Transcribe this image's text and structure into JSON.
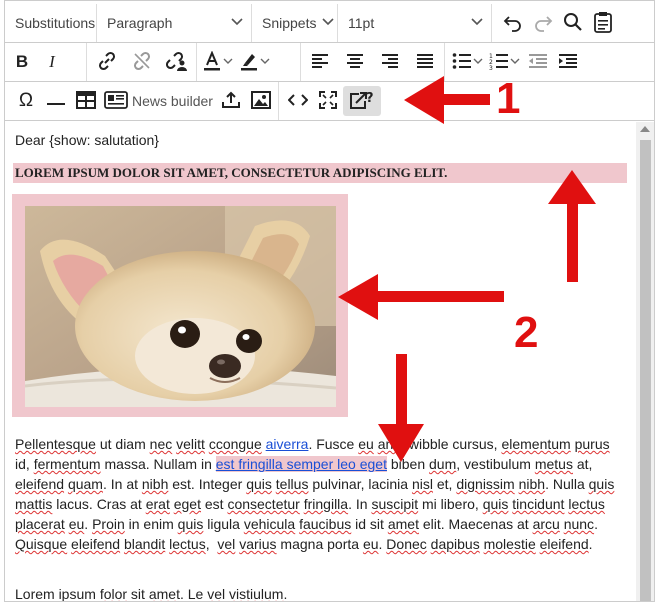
{
  "toolbar": {
    "row1": {
      "substitutions": "Substitutions",
      "paragraph": "Paragraph",
      "snippets": "Snippets",
      "font_size": "11pt"
    },
    "row3": {
      "news_builder": "News builder"
    }
  },
  "annotations": [
    "1",
    "2"
  ],
  "content": {
    "greeting": "Dear {show: salutation}",
    "heading": "LOREM IPSUM DOLOR SIT AMET, CONSECTETUR ADIPISCING ELIT.",
    "paragraph": {
      "s1": "Pellentesque",
      "s2": " ut diam ",
      "s3": "nec",
      "s4": " ",
      "s5": "velitt",
      "s6": " ",
      "s7": "ccongue",
      "s8": " ",
      "link1": "aiverra",
      "s9": ". Fusce ",
      "s10": "eu",
      "s11": " ",
      "s12": "ante",
      "s13": " wibble cursus, ",
      "s14": "elementum",
      "s15": " ",
      "s16": "purus",
      "s17": " id, ",
      "s18": "fermentum",
      "s19": " massa. Nullam in ",
      "link2": "est fringilla semper leo eget",
      "s20": " biben ",
      "s21": "dum",
      "s22": ", vestibulum ",
      "s23": "metus",
      "s24": " at, ",
      "s25": "eleifend",
      "s26": " ",
      "s27": "quam",
      "s28": ". In at ",
      "s29": "nibh",
      "s30": " est. Integer ",
      "s31": "quis",
      "s32": " ",
      "s33": "tellus",
      "s34": " pulvinar, lacinia ",
      "s35": "nisl",
      "s36": " et, ",
      "s37": "dignissim",
      "s38": " ",
      "s39": "nibh",
      "s40": ". Nulla ",
      "s41": "quis",
      "s42": " ",
      "s43": "mattis",
      "s44": " lacus. Cras at ",
      "s45": "erat",
      "s46": " ",
      "s47": "eget",
      "s48": " est ",
      "s49": "consectetur",
      "s50": " ",
      "s51": "fringilla",
      "s52": ". In ",
      "s53": "suscipit",
      "s54": " mi libero, ",
      "s55": "quis",
      "s56": " ",
      "s57": "tincidunt",
      "s58": " ",
      "s59": "lectus",
      "s60": " ",
      "s61": "placerat",
      "s62": " ",
      "s63": "eu",
      "s64": ". ",
      "s65": "Proin",
      "s66": " in enim ",
      "s67": "quis",
      "s68": " ligula ",
      "s69": "vehicula",
      "s70": " ",
      "s71": "faucibus",
      "s72": " id sit ",
      "s73": "amet",
      "s74": " elit. Maecenas at ",
      "s75": "arcu",
      "s76": " ",
      "s77": "nunc",
      "s78": ". ",
      "s79": "Quisque",
      "s80": " ",
      "s81": "eleifend",
      "s82": " ",
      "s83": "blandit",
      "s84": " ",
      "s85": "lectus",
      "s86": ",  ",
      "s87": "vel",
      "s88": " ",
      "s89": "varius",
      "s90": " magna porta ",
      "s91": "eu",
      "s92": ". ",
      "s93": "Donec",
      "s94": " ",
      "s95": "dapibus",
      "s96": " ",
      "s97": "molestie",
      "s98": " ",
      "s99": "eleifend",
      "s100": "."
    },
    "last_line": {
      "a": "Lorem ipsum ",
      "b": "folor",
      "c": " sit ",
      "d": "amet",
      "e": ". Le ",
      "f": "vel",
      "g": " ",
      "h": "vistiulum",
      "i": "."
    }
  },
  "colors": {
    "highlight": "#f0c7cd",
    "link": "#1a4fd6",
    "annotation": "#e01010"
  },
  "icons": [
    "undo-icon",
    "redo-icon",
    "search-icon",
    "paste-icon",
    "bold-icon",
    "italic-icon",
    "link-icon",
    "unlink-icon",
    "anchor-icon",
    "text-color-icon",
    "highlight-color-icon",
    "align-left-icon",
    "align-center-icon",
    "align-right-icon",
    "justify-icon",
    "bullet-list-icon",
    "numbered-list-icon",
    "outdent-icon",
    "indent-icon",
    "omega-icon",
    "horizontal-rule-icon",
    "table-icon",
    "news-builder-icon",
    "upload-icon",
    "image-icon",
    "code-icon",
    "fullscreen-icon",
    "popout-help-icon"
  ]
}
